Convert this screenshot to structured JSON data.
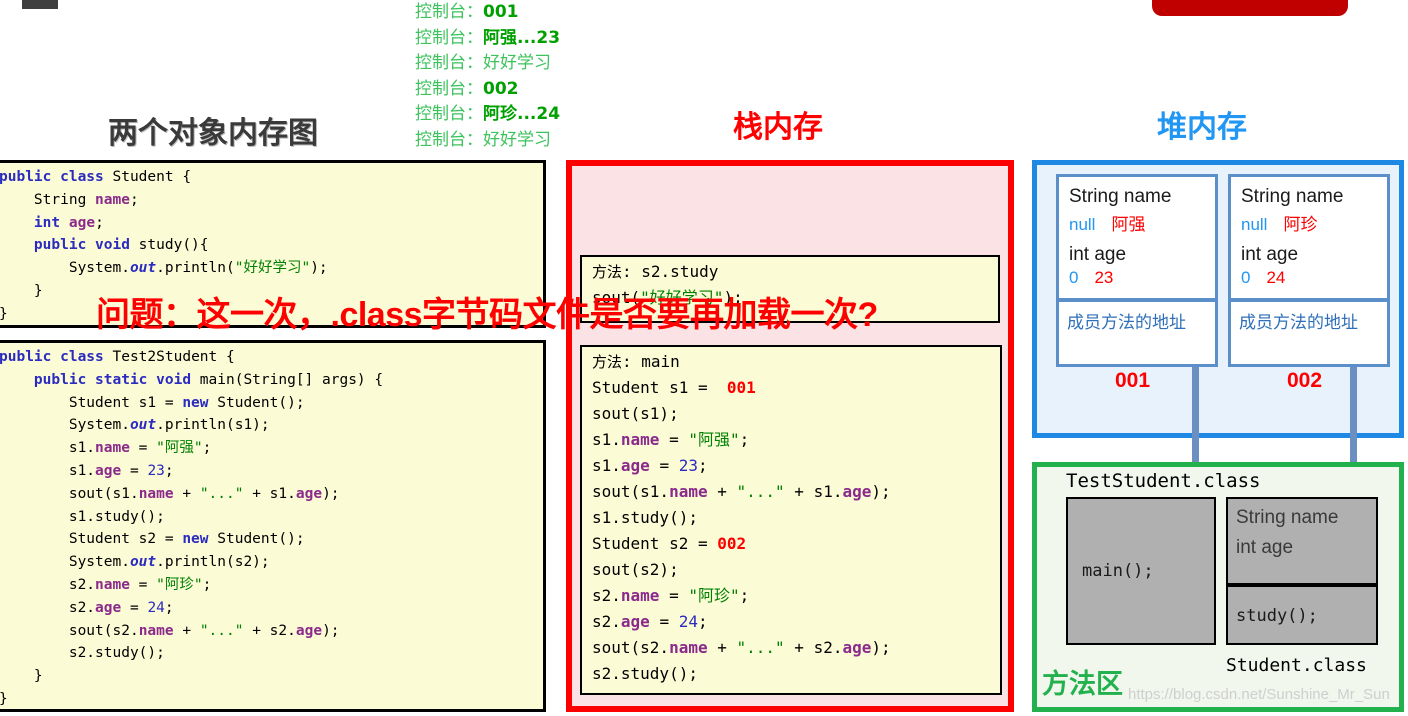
{
  "title_main": "两个对象内存图",
  "title_stack": "栈内存",
  "title_heap": "堆内存",
  "overlay_question": "问题：这一次，.class字节码文件是否要再加载一次?",
  "watermark": "https://blog.csdn.net/Sunshine_Mr_Sun",
  "colors": {
    "stack_red": "#ff0000",
    "heap_blue": "#2196f3",
    "method_green": "#22b14c",
    "code_bg": "#fbfbd6",
    "stack_bg": "#fbe2e4",
    "heap_bg": "#e8f2fd",
    "method_bg": "#f2f7ed",
    "console_green": "#2eb82e"
  },
  "console": {
    "prefix": "控制台：",
    "lines": [
      {
        "prefix": "控制台：",
        "value": "001",
        "kind": "addr"
      },
      {
        "prefix": "控制台：",
        "value": "阿强...23",
        "kind": "cn"
      },
      {
        "prefix": "控制台：",
        "value": "好好学习",
        "kind": "cn"
      },
      {
        "prefix": "控制台：",
        "value": "002",
        "kind": "addr"
      },
      {
        "prefix": "控制台：",
        "value": "阿珍...24",
        "kind": "cn"
      },
      {
        "prefix": "控制台：",
        "value": "好好学习",
        "kind": "cn"
      }
    ]
  },
  "code_student": {
    "lines": [
      "public class Student {",
      "    String name;",
      "    int age;",
      "    public void study(){",
      "        System.out.println(\"好好学习\");",
      "    }",
      "}"
    ]
  },
  "code_test": {
    "lines": [
      "public class Test2Student {",
      "    public static void main(String[] args) {",
      "        Student s1 = new Student();",
      "        System.out.println(s1);",
      "        s1.name = \"阿强\";",
      "        s1.age = 23;",
      "        sout(s1.name + \"...\" + s1.age);",
      "        s1.study();",
      "        Student s2 = new Student();",
      "        System.out.println(s2);",
      "        s2.name = \"阿珍\";",
      "        s2.age = 24;",
      "        sout(s2.name + \"...\" + s2.age);",
      "        s2.study();",
      "    }",
      "}"
    ]
  },
  "stack": {
    "frame_study": {
      "header": "方法: s2.study",
      "lines": [
        "sout(\"好好学习\");"
      ]
    },
    "frame_main": {
      "header": "方法: main",
      "lines": [
        "Student s1 =  001",
        "sout(s1);",
        "s1.name = \"阿强\";",
        "s1.age = 23;",
        "sout(s1.name + \"...\" + s1.age);",
        "s1.study();",
        "Student s2 =  002",
        "sout(s2);",
        "s2.name = \"阿珍\";",
        "s2.age = 24;",
        "sout(s2.name + \"...\" + s2.age);",
        "s2.study();"
      ]
    }
  },
  "heap": {
    "objects": [
      {
        "field_name_label": "String name",
        "name_null": "null",
        "name_value": "阿强",
        "field_age_label": "int age",
        "age_null": "0",
        "age_value": "23",
        "method_addr": "成员方法的地址",
        "address": "001"
      },
      {
        "field_name_label": "String name",
        "name_null": "null",
        "name_value": "阿珍",
        "field_age_label": "int age",
        "age_null": "0",
        "age_value": "24",
        "method_addr": "成员方法的地址",
        "address": "002"
      }
    ]
  },
  "method_area": {
    "label": "方法区",
    "test_class_title": "TestStudent.class",
    "main_box": "main();",
    "student_field_name": "String name",
    "student_field_age": "int age",
    "student_method": "study();",
    "student_class_label": "Student.class"
  }
}
